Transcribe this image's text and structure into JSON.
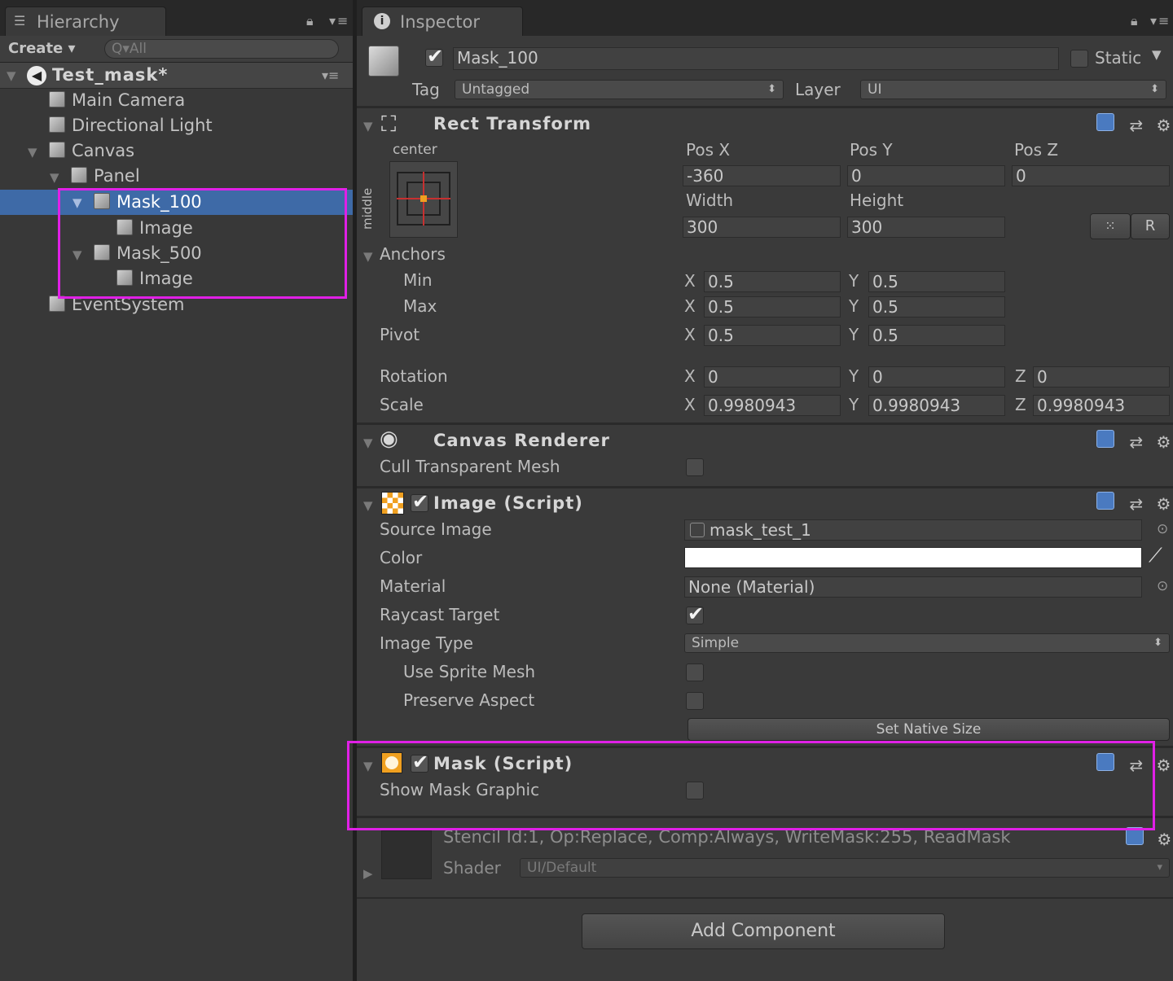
{
  "hierarchy": {
    "tab_label": "Hierarchy",
    "tab_icon": "list-icon",
    "create_label": "Create ▾",
    "search_placeholder": "Q▾All",
    "scene_name": "Test_mask*",
    "items": {
      "main_camera": "Main Camera",
      "directional_light": "Directional Light",
      "canvas": "Canvas",
      "panel": "Panel",
      "mask_100": "Mask_100",
      "image_1": "Image",
      "mask_500": "Mask_500",
      "image_2": "Image",
      "event_system": "EventSystem"
    }
  },
  "inspector": {
    "tab_label": "Inspector",
    "object_name": "Mask_100",
    "static_label": "Static",
    "tag_label": "Tag",
    "tag_value": "Untagged",
    "layer_label": "Layer",
    "layer_value": "UI"
  },
  "rect_transform": {
    "title": "Rect Transform",
    "anchor_h": "center",
    "anchor_v": "middle",
    "pos_x_label": "Pos X",
    "pos_y_label": "Pos Y",
    "pos_z_label": "Pos Z",
    "pos_x": "-360",
    "pos_y": "0",
    "pos_z": "0",
    "width_label": "Width",
    "height_label": "Height",
    "width": "300",
    "height": "300",
    "r_button": "R",
    "anchors_label": "Anchors",
    "min_label": "Min",
    "max_label": "Max",
    "pivot_label": "Pivot",
    "rotation_label": "Rotation",
    "scale_label": "Scale",
    "x": "X",
    "y": "Y",
    "z": "Z",
    "min_x": "0.5",
    "min_y": "0.5",
    "max_x": "0.5",
    "max_y": "0.5",
    "pivot_x": "0.5",
    "pivot_y": "0.5",
    "rot_x": "0",
    "rot_y": "0",
    "rot_z": "0",
    "scale_x": "0.9980943",
    "scale_y": "0.9980943",
    "scale_z": "0.9980943"
  },
  "canvas_renderer": {
    "title": "Canvas Renderer",
    "cull_label": "Cull Transparent Mesh",
    "cull_checked": false
  },
  "image_script": {
    "title": "Image (Script)",
    "source_image_label": "Source Image",
    "source_image_value": "mask_test_1",
    "color_label": "Color",
    "color_value": "#ffffff",
    "material_label": "Material",
    "material_value": "None (Material)",
    "raycast_label": "Raycast Target",
    "raycast_checked": true,
    "image_type_label": "Image Type",
    "image_type_value": "Simple",
    "use_sprite_mesh_label": "Use Sprite Mesh",
    "preserve_aspect_label": "Preserve Aspect",
    "set_native_size": "Set Native Size"
  },
  "mask_script": {
    "title": "Mask (Script)",
    "show_mask_graphic_label": "Show Mask Graphic",
    "show_mask_graphic_checked": false
  },
  "material_preview": {
    "stencil_text": "Stencil Id:1, Op:Replace, Comp:Always, WriteMask:255, ReadMask",
    "shader_label": "Shader",
    "shader_value": "UI/Default"
  },
  "add_component": "Add Component",
  "colors": {
    "selection": "#3e6aa7",
    "highlight_box": "#e020e6",
    "panel_bg": "#383838"
  }
}
